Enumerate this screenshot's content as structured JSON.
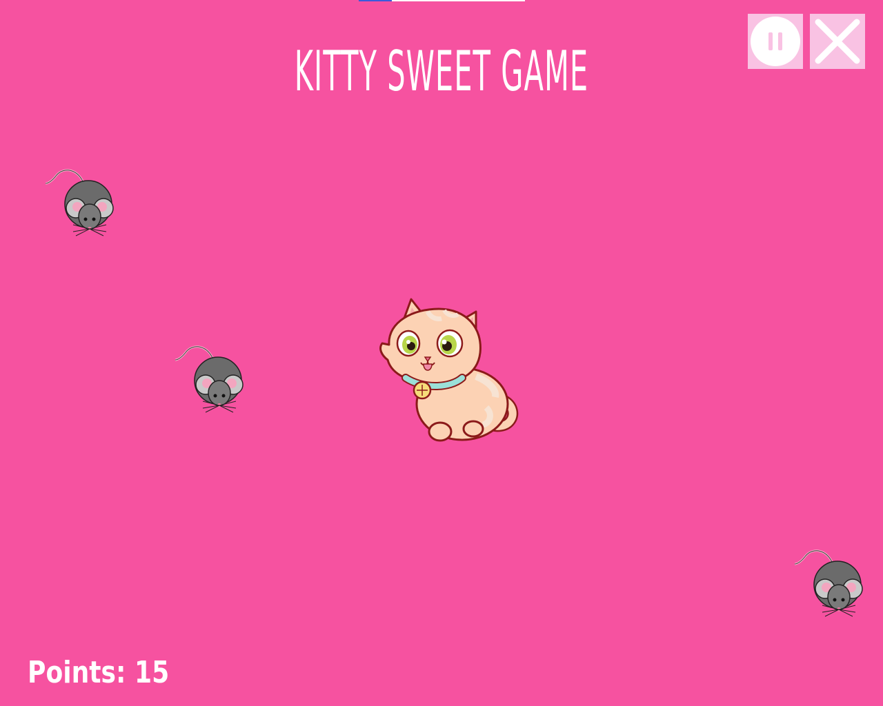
{
  "game": {
    "title": "KITTY SWEET GAME",
    "points_label": "Points: 15",
    "points": 15,
    "progress_fraction": 0.2
  },
  "controls": {
    "pause_icon": "pause-icon",
    "close_icon": "close-icon"
  },
  "colors": {
    "background": "#f652a0",
    "button_bg": "#f9c2e3",
    "text": "#ffffff",
    "progress_fill": "#3b5bdb",
    "mouse_body": "#6b6b6b",
    "kitty_fur": "#fcd2b4"
  },
  "sprites": {
    "player": "kitty",
    "enemies": [
      "mouse",
      "mouse",
      "mouse"
    ]
  }
}
